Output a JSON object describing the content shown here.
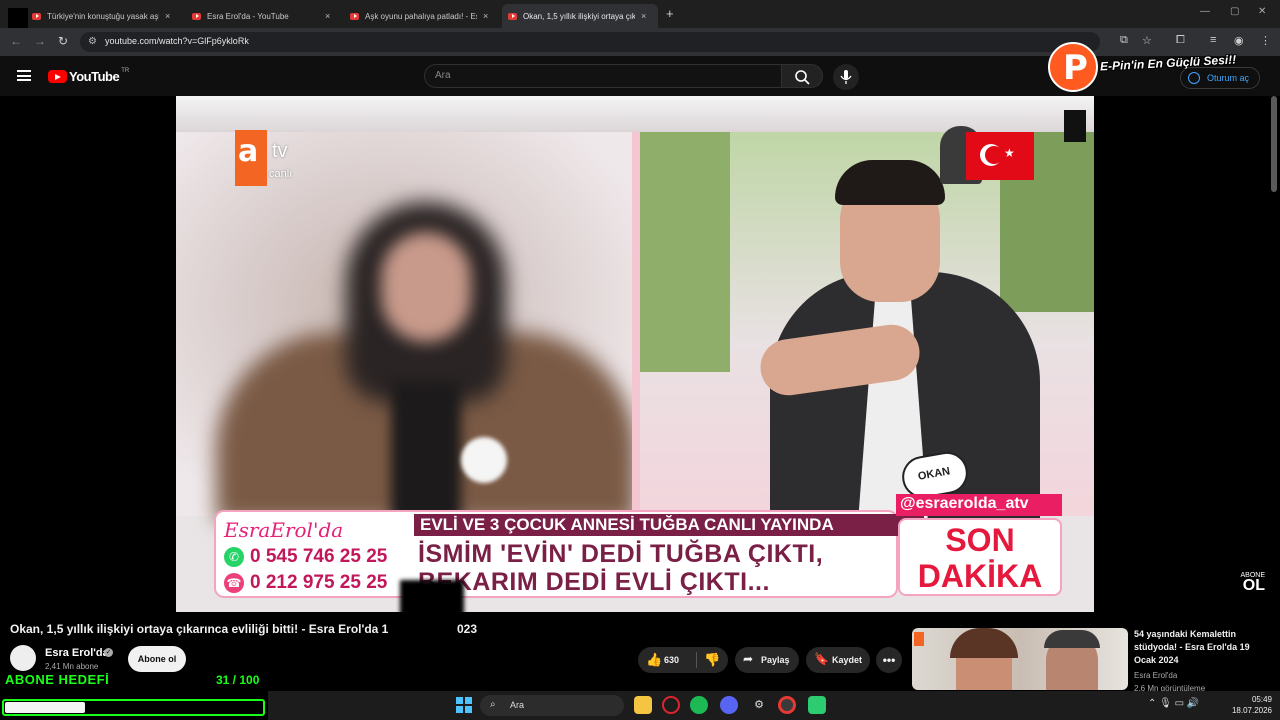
{
  "browser": {
    "tabs": [
      {
        "title": "Türkiye'nin konuştuğu yasak aşk",
        "active": false
      },
      {
        "title": "Esra Erol'da - YouTube",
        "active": false
      },
      {
        "title": "Aşk oyunu pahalıya patladı! - Es",
        "active": false
      },
      {
        "title": "Okan, 1,5 yıllık ilişkiyi ortaya çık",
        "active": true
      }
    ],
    "close_glyph": "×",
    "new_tab_glyph": "+",
    "url": "youtube.com/watch?v=GlFp6ykloRk",
    "icons": [
      "back-icon",
      "forward-icon",
      "reload-icon",
      "tune-icon",
      "cast-icon",
      "star-icon",
      "extensions-icon",
      "media-icon",
      "profile-icon",
      "menu-icon"
    ]
  },
  "youtube_header": {
    "logo_text": "YouTube",
    "country": "TR",
    "search_placeholder": "Ara",
    "signin_label": "Oturum aç"
  },
  "overlay": {
    "epin_letter": "P",
    "epin_text": "E-Pin'in En Güçlü Sesi!!"
  },
  "video": {
    "atv_letter": "a",
    "atv_tv": "tv",
    "atv_canli": "canlı",
    "okan_badge": "OKAN",
    "brand": "EsraErol'da",
    "phone1": "0 545 746 25 25",
    "phone2": "0 212 975 25 25",
    "headline": "EVLİ VE 3 ÇOCUK ANNESİ TUĞBA CANLI YAYINDA",
    "line1": "İSMİM 'EVİN' DEDİ TUĞBA ÇIKTI,",
    "line2": "BEKARIM DEDİ EVLİ ÇIKTI...",
    "instagram": "@esraerolda_atv",
    "son": "SON",
    "dakika": "DAKİKA",
    "abone_small": "ABONE",
    "abone_ol": "OL"
  },
  "watch": {
    "title": "Okan, 1,5 yıllık ilişkiyi ortaya çıkarınca evliliği bitti! - Esra Erol'da 1",
    "title_tail": "023",
    "channel": "Esra Erol'da",
    "subscribers": "2,41 Mn abone",
    "subscribe_label": "Abone ol",
    "likes": "630",
    "share_label": "Paylaş",
    "save_label": "Kaydet",
    "more_glyph": "•••"
  },
  "recommendation": {
    "title": "54 yaşındaki Kemalettin stüdyoda! - Esra Erol'da 19 Ocak 2024",
    "channel": "Esra Erol'da",
    "meta": "2,6 Mn görüntüleme"
  },
  "goal": {
    "label": "ABONE HEDEFİ",
    "count": "31 / 100",
    "progress_fraction": 0.31
  },
  "taskbar": {
    "search_label": "Ara",
    "time": "05:49",
    "date": "18.07.2026"
  }
}
